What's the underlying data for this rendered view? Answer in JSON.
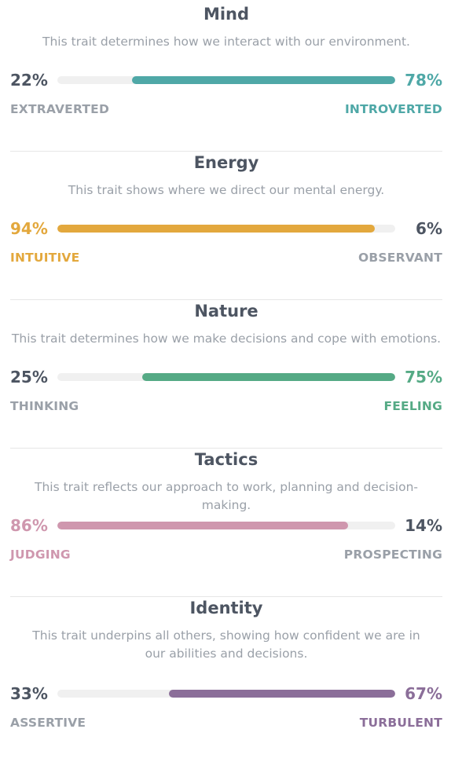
{
  "traits": [
    {
      "title": "Mind",
      "description": "This trait determines how we interact with our environment.",
      "left_pct": "22%",
      "right_pct": "78%",
      "left_label": "EXTRAVERTED",
      "right_label": "INTROVERTED",
      "dominant": "right",
      "fill_fraction": 0.78,
      "color": "#4fa8a7"
    },
    {
      "title": "Energy",
      "description": "This trait shows where we direct our mental energy.",
      "left_pct": "94%",
      "right_pct": "6%",
      "left_label": "INTUITIVE",
      "right_label": "OBSERVANT",
      "dominant": "left",
      "fill_fraction": 0.94,
      "color": "#e3a83d"
    },
    {
      "title": "Nature",
      "description": "This trait determines how we make decisions and cope with emotions.",
      "left_pct": "25%",
      "right_pct": "75%",
      "left_label": "THINKING",
      "right_label": "FEELING",
      "dominant": "right",
      "fill_fraction": 0.75,
      "color": "#55aa85"
    },
    {
      "title": "Tactics",
      "description": "This trait reflects our approach to work, planning and decision-making.",
      "left_pct": "86%",
      "right_pct": "14%",
      "left_label": "JUDGING",
      "right_label": "PROSPECTING",
      "dominant": "left",
      "fill_fraction": 0.86,
      "color": "#cf97ae"
    },
    {
      "title": "Identity",
      "description": "This trait underpins all others, showing how confident we are in our abilities and decisions.",
      "left_pct": "33%",
      "right_pct": "67%",
      "left_label": "ASSERTIVE",
      "right_label": "TURBULENT",
      "dominant": "right",
      "fill_fraction": 0.67,
      "color": "#8b6e99"
    }
  ]
}
